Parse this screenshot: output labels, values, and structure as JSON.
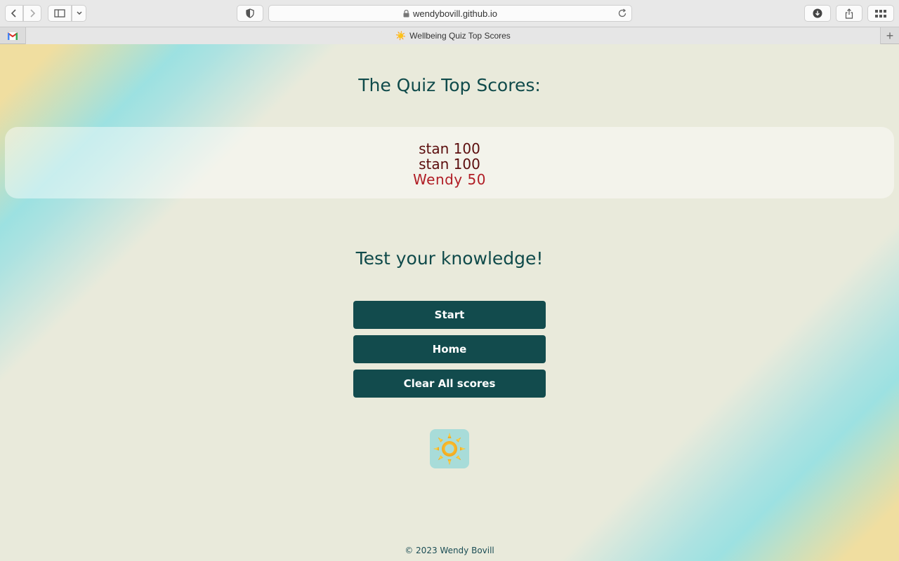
{
  "browser": {
    "url": "wendybovill.github.io",
    "tab_title": "Wellbeing Quiz Top Scores",
    "new_tab_label": "+"
  },
  "page": {
    "heading": "The Quiz Top Scores:",
    "scores": [
      {
        "text": "stan 100"
      },
      {
        "text": "stan 100"
      },
      {
        "text": "Wendy 50"
      }
    ],
    "subheading": "Test your knowledge!",
    "buttons": {
      "start": "Start",
      "home": "Home",
      "clear": "Clear All scores"
    },
    "footer": "© 2023 Wendy Bovill"
  },
  "colors": {
    "heading": "#0f4a4a",
    "button_bg": "#124b4d",
    "score_text": "#5b0d0d",
    "latest_score_text": "#b01d25",
    "page_bg": "#e9eadb",
    "accent_teal": "#94e0e2",
    "accent_sand": "#f0dea0"
  },
  "icons": {
    "back": "chevron-left-icon",
    "forward": "chevron-right-icon",
    "sidebar": "sidebar-icon",
    "privacy": "shield-icon",
    "lock": "lock-icon",
    "reload": "reload-icon",
    "downloads": "download-icon",
    "share": "share-icon",
    "tab_overview": "grid-icon",
    "gmail": "gmail-icon",
    "logo": "sun-icon"
  }
}
